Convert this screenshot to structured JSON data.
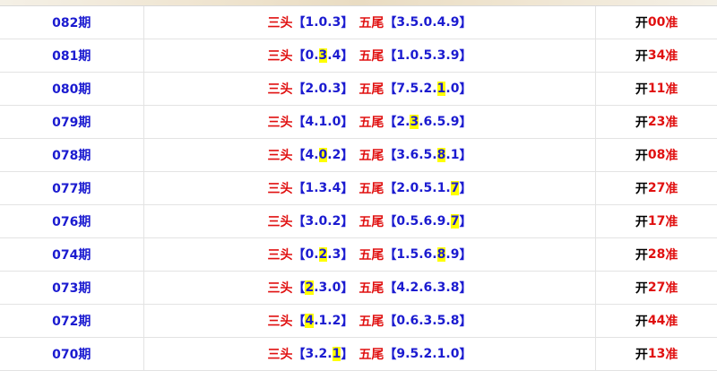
{
  "labels": {
    "san_tou": "三头",
    "wu_wei": "五尾",
    "kai": "开",
    "zhun": "准"
  },
  "rows": [
    {
      "period": "082期",
      "san_tou": [
        {
          "d": "1"
        },
        {
          "d": "0"
        },
        {
          "d": "3"
        }
      ],
      "wu_wei": [
        {
          "d": "3"
        },
        {
          "d": "5"
        },
        {
          "d": "0"
        },
        {
          "d": "4"
        },
        {
          "d": "9"
        }
      ],
      "result": "00"
    },
    {
      "period": "081期",
      "san_tou": [
        {
          "d": "0"
        },
        {
          "d": "3",
          "hl": true
        },
        {
          "d": "4"
        }
      ],
      "wu_wei": [
        {
          "d": "1"
        },
        {
          "d": "0"
        },
        {
          "d": "5"
        },
        {
          "d": "3"
        },
        {
          "d": "9"
        }
      ],
      "result": "34"
    },
    {
      "period": "080期",
      "san_tou": [
        {
          "d": "2"
        },
        {
          "d": "0"
        },
        {
          "d": "3"
        }
      ],
      "wu_wei": [
        {
          "d": "7"
        },
        {
          "d": "5"
        },
        {
          "d": "2"
        },
        {
          "d": "1",
          "hl": true
        },
        {
          "d": "0"
        }
      ],
      "result": "11"
    },
    {
      "period": "079期",
      "san_tou": [
        {
          "d": "4"
        },
        {
          "d": "1"
        },
        {
          "d": "0"
        }
      ],
      "wu_wei": [
        {
          "d": "2"
        },
        {
          "d": "3",
          "hl": true
        },
        {
          "d": "6"
        },
        {
          "d": "5"
        },
        {
          "d": "9"
        }
      ],
      "result": "23"
    },
    {
      "period": "078期",
      "san_tou": [
        {
          "d": "4"
        },
        {
          "d": "0",
          "hl": true
        },
        {
          "d": "2"
        }
      ],
      "wu_wei": [
        {
          "d": "3"
        },
        {
          "d": "6"
        },
        {
          "d": "5"
        },
        {
          "d": "8",
          "hl": true
        },
        {
          "d": "1"
        }
      ],
      "result": "08"
    },
    {
      "period": "077期",
      "san_tou": [
        {
          "d": "1"
        },
        {
          "d": "3"
        },
        {
          "d": "4"
        }
      ],
      "wu_wei": [
        {
          "d": "2"
        },
        {
          "d": "0"
        },
        {
          "d": "5"
        },
        {
          "d": "1"
        },
        {
          "d": "7",
          "hl": true
        }
      ],
      "result": "27"
    },
    {
      "period": "076期",
      "san_tou": [
        {
          "d": "3"
        },
        {
          "d": "0"
        },
        {
          "d": "2"
        }
      ],
      "wu_wei": [
        {
          "d": "0"
        },
        {
          "d": "5"
        },
        {
          "d": "6"
        },
        {
          "d": "9"
        },
        {
          "d": "7",
          "hl": true
        }
      ],
      "result": "17"
    },
    {
      "period": "074期",
      "san_tou": [
        {
          "d": "0"
        },
        {
          "d": "2",
          "hl": true
        },
        {
          "d": "3"
        }
      ],
      "wu_wei": [
        {
          "d": "1"
        },
        {
          "d": "5"
        },
        {
          "d": "6"
        },
        {
          "d": "8",
          "hl": true
        },
        {
          "d": "9"
        }
      ],
      "result": "28"
    },
    {
      "period": "073期",
      "san_tou": [
        {
          "d": "2",
          "hl": true
        },
        {
          "d": "3"
        },
        {
          "d": "0"
        }
      ],
      "wu_wei": [
        {
          "d": "4"
        },
        {
          "d": "2"
        },
        {
          "d": "6"
        },
        {
          "d": "3"
        },
        {
          "d": "8"
        }
      ],
      "result": "27"
    },
    {
      "period": "072期",
      "san_tou": [
        {
          "d": "4",
          "hl": true
        },
        {
          "d": "1"
        },
        {
          "d": "2"
        }
      ],
      "wu_wei": [
        {
          "d": "0"
        },
        {
          "d": "6"
        },
        {
          "d": "3"
        },
        {
          "d": "5"
        },
        {
          "d": "8"
        }
      ],
      "result": "44"
    },
    {
      "period": "070期",
      "san_tou": [
        {
          "d": "3"
        },
        {
          "d": "2"
        },
        {
          "d": "1",
          "hl": true
        }
      ],
      "wu_wei": [
        {
          "d": "9"
        },
        {
          "d": "5"
        },
        {
          "d": "2"
        },
        {
          "d": "1"
        },
        {
          "d": "0"
        }
      ],
      "result": "13"
    }
  ]
}
